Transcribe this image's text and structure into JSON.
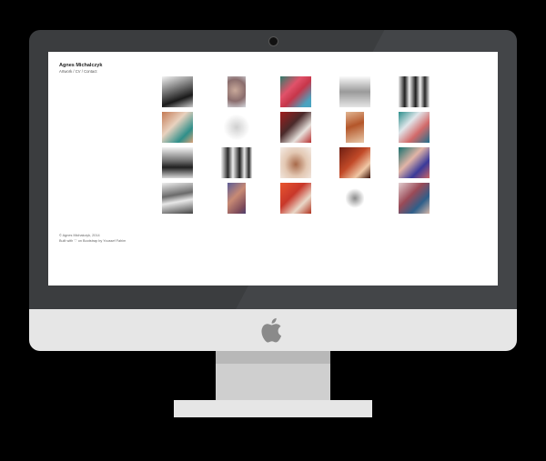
{
  "site": {
    "title": "Agnes Michalczyk",
    "nav": [
      {
        "label": "Artwork"
      },
      {
        "label": "CV"
      },
      {
        "label": "Contact"
      }
    ],
    "nav_separator": "/"
  },
  "gallery": {
    "thumbnails": [
      {
        "icon": "artwork-thumbnail",
        "palette": [
          "#1a1a1a",
          "#f4f4f4"
        ]
      },
      {
        "icon": "artwork-thumbnail",
        "palette": [
          "#c9a99a",
          "#8a6d6d"
        ]
      },
      {
        "icon": "artwork-thumbnail",
        "palette": [
          "#e0526a",
          "#2e7d6c"
        ]
      },
      {
        "icon": "artwork-thumbnail",
        "palette": [
          "#9a9a9a",
          "#fafafa"
        ]
      },
      {
        "icon": "artwork-thumbnail",
        "palette": [
          "#202020",
          "#e8e8e8"
        ]
      },
      {
        "icon": "artwork-thumbnail",
        "palette": [
          "#c47a55",
          "#2f8f8a"
        ]
      },
      {
        "icon": "artwork-thumbnail",
        "palette": [
          "#cfcfcf",
          "#ffffff"
        ]
      },
      {
        "icon": "artwork-thumbnail",
        "palette": [
          "#a01d1d",
          "#e7e1dc"
        ]
      },
      {
        "icon": "artwork-thumbnail",
        "palette": [
          "#b4562a",
          "#f0d7b8"
        ]
      },
      {
        "icon": "artwork-thumbnail",
        "palette": [
          "#2c8f8c",
          "#d36a6a"
        ]
      },
      {
        "icon": "artwork-thumbnail",
        "palette": [
          "#202020",
          "#f3f3f3"
        ]
      },
      {
        "icon": "artwork-thumbnail",
        "palette": [
          "#2a2a2a",
          "#f0f0f0"
        ]
      },
      {
        "icon": "artwork-thumbnail",
        "palette": [
          "#a86a4a",
          "#e3c8b3"
        ]
      },
      {
        "icon": "artwork-thumbnail",
        "palette": [
          "#6e1e12",
          "#c24a28"
        ]
      },
      {
        "icon": "artwork-thumbnail",
        "palette": [
          "#18706e",
          "#e2b5a7"
        ]
      },
      {
        "icon": "artwork-thumbnail",
        "palette": [
          "#6a6a6a",
          "#eeeeee"
        ]
      },
      {
        "icon": "artwork-thumbnail",
        "palette": [
          "#3c4fa0",
          "#c88a74"
        ]
      },
      {
        "icon": "artwork-thumbnail",
        "palette": [
          "#e8552f",
          "#e9d8c8"
        ]
      },
      {
        "icon": "artwork-thumbnail",
        "palette": [
          "#8c8c8c",
          "#ffffff"
        ]
      },
      {
        "icon": "artwork-thumbnail",
        "palette": [
          "#9a4a57",
          "#2e5f8a"
        ]
      }
    ]
  },
  "footer": {
    "copyright": "© Agnes Michalczyk, 2014",
    "credit": "Built with ♡ on Bootstrap by Youssef Fahim"
  },
  "device": {
    "bezel_color": "#3b3d3f",
    "chin_color": "#e6e6e6",
    "logo_icon": "apple-logo-icon",
    "logo_color": "#8a8a8a"
  }
}
